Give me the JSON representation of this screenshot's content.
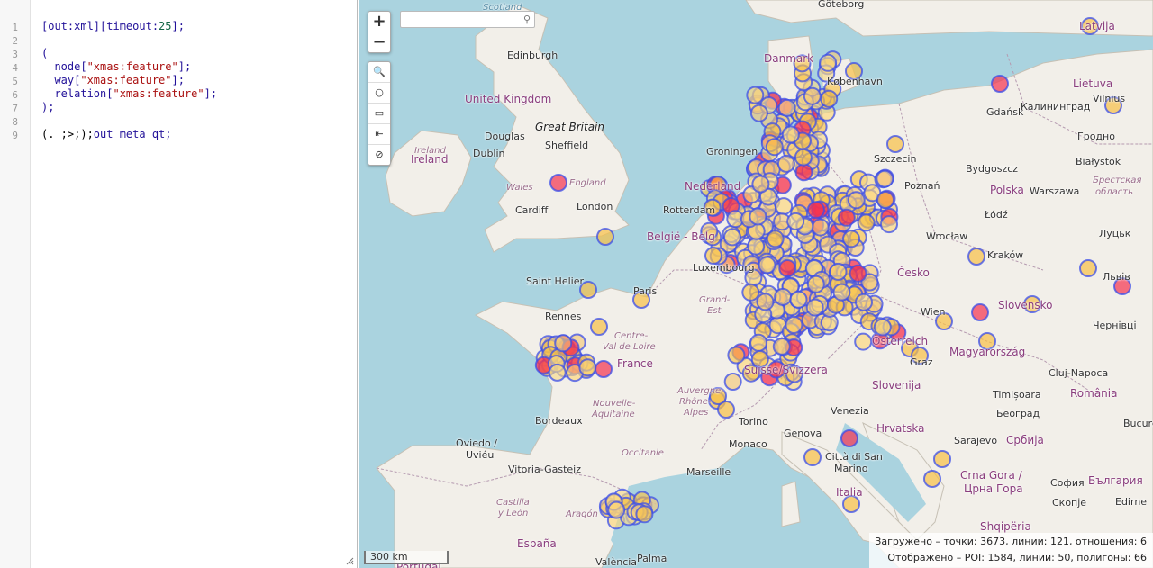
{
  "editor": {
    "line_numbers": [
      "1",
      "2",
      "3",
      "4",
      "5",
      "6",
      "7",
      "8",
      "9"
    ],
    "lines": {
      "l1": {
        "a": "[out:xml][timeout:",
        "n": "25",
        "b": "];"
      },
      "l3": "(",
      "l4": {
        "a": "  node[",
        "s": "\"xmas:feature\"",
        "b": "];"
      },
      "l5": {
        "a": "  way[",
        "s": "\"xmas:feature\"",
        "b": "];"
      },
      "l6": {
        "a": "  relation[",
        "s": "\"xmas:feature\"",
        "b": "];"
      },
      "l7": ");",
      "l9": {
        "a": "(._;>;);",
        "b": "out meta qt;"
      }
    }
  },
  "map": {
    "zoom_in": "+",
    "zoom_out": "−",
    "tools": [
      "🔍",
      "○",
      "▭",
      "⇤",
      "⊘"
    ],
    "search_placeholder": "",
    "scale_label": "300 km",
    "stats": {
      "loaded": "Загружено – точки: 3673, линии: 121, отношения: 6",
      "shown": "Отображено – POI: 1584, линии: 50, полигоны: 66"
    },
    "labels": {
      "scotland": "Scotland",
      "goteborg": "Göteborg",
      "latvija": "Latvija",
      "edinburgh": "Edinburgh",
      "danmark": "Danmark",
      "kobenhavn": "København",
      "lietuva": "Lietuva",
      "vilnius": "Vilnius",
      "uk": "United Kingdom",
      "gdansk": "Gdańsk",
      "kaliningrad": "Калининград",
      "douglas": "Douglas",
      "great_britain": "Great Britain",
      "sheffield": "Sheffield",
      "grodno": "Гродно",
      "ireland_label": "Ireland",
      "ireland": "Ireland",
      "dublin": "Dublin",
      "groningen": "Groningen",
      "szczecin": "Szczecin",
      "bydgoszcz": "Bydgoszcz",
      "bialystok": "Białystok",
      "wales": "Wales",
      "england": "England",
      "nederland": "Nederland",
      "poznan": "Poznań",
      "polska": "Polska",
      "warszawa": "Warszawa",
      "brest": "Брестская",
      "oblast": "область",
      "cardiff": "Cardiff",
      "london": "London",
      "rotterdam": "Rotterdam",
      "lodz": "Łódź",
      "belgie": "België - Belg",
      "wroclaw": "Wrocław",
      "lutsk": "Луцьк",
      "luxembourg": "Luxembourg",
      "krakow": "Kraków",
      "cesko": "Česko",
      "lviv": "Львів",
      "saint_helier": "Saint Helier",
      "paris": "Paris",
      "grand_est": "Grand-",
      "est": "Est",
      "slovensko": "Slovensko",
      "rennes": "Rennes",
      "wien": "Wien",
      "chernivtsi": "Чернівці",
      "centre": "Centre-",
      "val_de_loire": "Val de Loire",
      "osterreich": "Österreich",
      "magyarorszag": "Magyarország",
      "france": "France",
      "suisse": "Suisse/Svizzera",
      "graz": "Graz",
      "cluj": "Cluj-Napoca",
      "slovenija": "Slovenija",
      "nouvelle": "Nouvelle-",
      "aquitaine": "Aquitaine",
      "auvergne": "Auvergne-",
      "rhone": "Rhône-",
      "alpes": "Alpes",
      "timisoara": "Timișoara",
      "romania": "România",
      "bordeaux": "Bordeaux",
      "torino": "Torino",
      "venezia": "Venezia",
      "beograd": "Београд",
      "bucuresti": "Bucureș",
      "hrvatska": "Hrvatska",
      "oviedo": "Oviedo /",
      "uvieu": "Uviéu",
      "occitanie": "Occitanie",
      "monaco": "Monaco",
      "genova": "Genova",
      "sarajevo": "Sarajevo",
      "srbija": "Србија",
      "citta": "Città di San",
      "marino": "Marino",
      "vitoria": "Vitoria-Gasteiz",
      "marseille": "Marseille",
      "crna_gora": "Crna Gora /",
      "crna_gora2": "Црна Гора",
      "sofia": "София",
      "bulgaria": "България",
      "castilla": "Castilla",
      "leon": "y León",
      "aragon": "Aragón",
      "italia": "Italia",
      "skopje": "Скопје",
      "edirne": "Edirne",
      "espana": "España",
      "shqiperia": "Shqipëria",
      "portugal": "Portugal",
      "valencia": "València",
      "palma": "Palma"
    }
  }
}
